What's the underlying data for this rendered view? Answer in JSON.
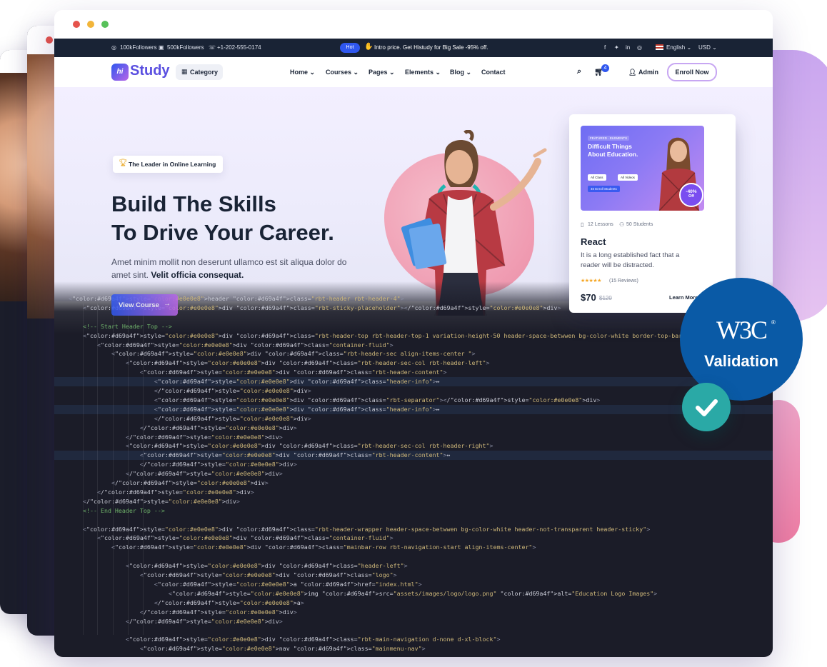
{
  "topbar": {
    "followers_ig": "100kFollowers",
    "followers_fb": "500kFollowers",
    "phone": "+1-202-555-0174",
    "hot_label": "Hot",
    "promo": "Intro price. Get Histudy for Big Sale -95% off.",
    "language": "English",
    "currency": "USD"
  },
  "nav": {
    "logo_prefix": "hi",
    "logo_text": "Study",
    "category": "Category",
    "menu": [
      "Home",
      "Courses",
      "Pages",
      "Elements",
      "Blog",
      "Contact"
    ],
    "cart_count": "4",
    "admin": "Admin",
    "enroll": "Enroll Now"
  },
  "hero": {
    "badge": "The Leader in Online Learning",
    "title_line1": "Build The Skills",
    "title_line2": "To Drive Your Career.",
    "desc_line1": "Amet minim mollit non deserunt ullamco est sit aliqua dolor do",
    "desc_line2_a": "amet sint. ",
    "desc_line2_b": "Velit officia consequat.",
    "cta": "View Course"
  },
  "course_card": {
    "banner_tag": "FEATURED · ELEMENTS",
    "banner_title_1": "Difficult Things",
    "banner_title_2": "About Education.",
    "banner_pill_1": "All Class",
    "banner_pill_2": "All Videos",
    "banner_pill_3": "40 Enroll Students",
    "discount": "-40%",
    "discount_suffix": "Off",
    "lessons": "12 Lessons",
    "students": "50 Students",
    "title": "React",
    "desc_line1": "It is a long established fact that a",
    "desc_line2": "reader will be distracted.",
    "reviews": "(15 Reviews)",
    "rating": 5,
    "price": "$70",
    "old_price": "$120",
    "learn_more": "Learn More"
  },
  "badge": {
    "logo": "W3C",
    "label": "Validation"
  },
  "code_lines": [
    "<header class=\"rbt-header rbt-header-4\">",
    "    <div class=\"rbt-sticky-placeholder\"></div>",
    "",
    "    <!-- Start Header Top -->",
    "    <div class=\"rbt-header-top rbt-header-top-1 variation-height-50 header-space-betwwen bg-color-white border-top-bar-primary-color rbt-border-bottom d-none d-xl-block\">",
    "        <div class=\"container-fluid\">",
    "            <div class=\"rbt-header-sec align-items-center \">",
    "                <div class=\"rbt-header-sec-col rbt-header-left\">",
    "                    <div class=\"rbt-header-content\">",
    "                        <div class=\"header-info\">↔",
    "                        </div>",
    "                        <div class=\"rbt-separator\"></div>",
    "                        <div class=\"header-info\">↔",
    "                        </div>",
    "                    </div>",
    "                </div>",
    "                <div class=\"rbt-header-sec-col rbt-header-right\">",
    "                    <div class=\"rbt-header-content\">↔",
    "                    </div>",
    "                </div>",
    "            </div>",
    "        </div>",
    "    </div>",
    "    <!-- End Header Top -->",
    "",
    "    <div class=\"rbt-header-wrapper header-space-betwwen bg-color-white header-not-transparent header-sticky\">",
    "        <div class=\"container-fluid\">",
    "            <div class=\"mainbar-row rbt-navigation-start align-items-center\">",
    "",
    "                <div class=\"header-left\">",
    "                    <div class=\"logo\">",
    "                        <a href=\"index.html\">",
    "                            <img src=\"assets/images/logo/logo.png\" alt=\"Education Logo Images\">",
    "                        </a>",
    "                    </div>",
    "                </div>",
    "",
    "                <div class=\"rbt-main-navigation d-none d-xl-block\">",
    "                    <nav class=\"mainmenu-nav\">"
  ],
  "colors": {
    "primary": "#2f57ef",
    "accent": "#b966e7",
    "dark": "#192335",
    "code_bg": "#1b1c28",
    "w3c_blue": "#0a5aa6",
    "check_teal": "#2aa9a6"
  }
}
